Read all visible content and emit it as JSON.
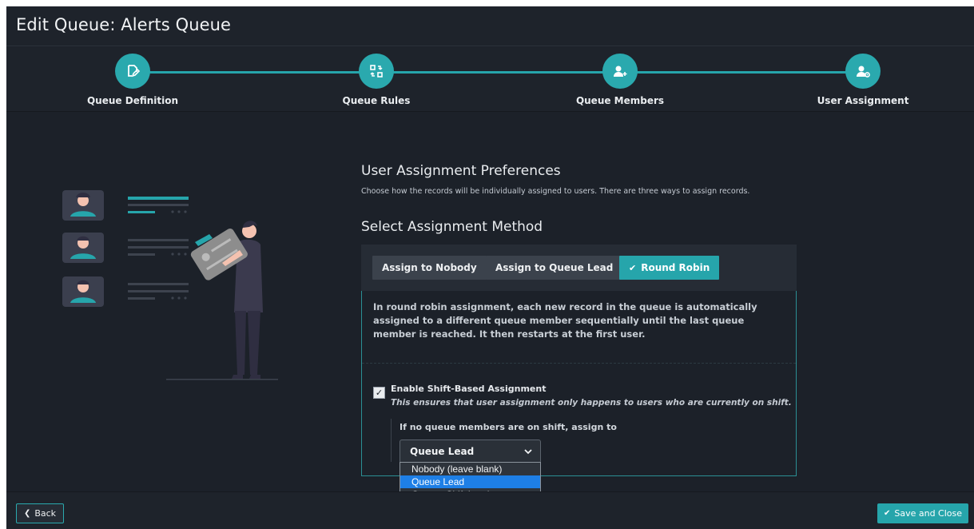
{
  "header": {
    "title": "Edit Queue: Alerts Queue"
  },
  "steps": [
    {
      "label": "Queue Definition",
      "icon": "edit-document-icon"
    },
    {
      "label": "Queue Rules",
      "icon": "swap-rules-icon"
    },
    {
      "label": "Queue Members",
      "icon": "add-user-icon"
    },
    {
      "label": "User Assignment",
      "icon": "user-settings-icon"
    }
  ],
  "main": {
    "heading": "User Assignment Preferences",
    "subheading": "Choose how the records will be individually assigned to users. There are three ways to assign records.",
    "method_heading": "Select Assignment Method",
    "methods": [
      {
        "label": "Assign to Nobody",
        "active": false
      },
      {
        "label": "Assign to Queue Lead",
        "active": false
      },
      {
        "label": "Round Robin",
        "active": true,
        "icon": "check-icon"
      }
    ],
    "description": "In round robin assignment, each new record in the queue is automatically assigned to a different queue member sequentially until the last queue member is reached. It then restarts at the first user.",
    "shift": {
      "checked": true,
      "check_glyph": "✓",
      "label": "Enable Shift-Based Assignment",
      "help": "This ensures that user assignment only happens to users who are currently on shift."
    },
    "fallback": {
      "label": "If no queue members are on shift, assign to",
      "selected": "Queue Lead",
      "options": [
        "Nobody (leave blank)",
        "Queue Lead",
        "Current Shift Lead"
      ]
    }
  },
  "footer": {
    "back_label": "Back",
    "save_label": "Save and Close"
  },
  "colors": {
    "accent": "#26a5ab",
    "background": "#1c2129",
    "selected_option": "#1e7fe6"
  }
}
